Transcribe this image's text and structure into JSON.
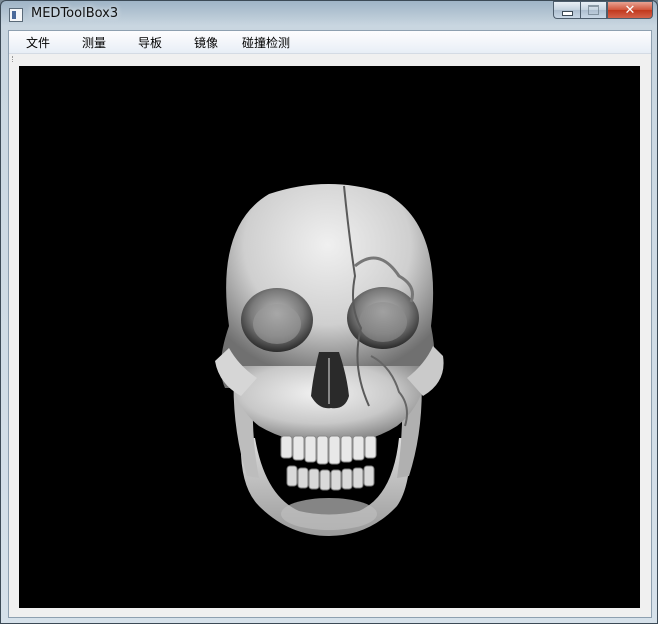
{
  "window": {
    "title": "MEDToolBox3"
  },
  "menu": {
    "items": [
      {
        "label": "文件"
      },
      {
        "label": "测量"
      },
      {
        "label": "导板"
      },
      {
        "label": "镜像"
      },
      {
        "label": "碰撞检测"
      }
    ]
  },
  "viewport": {
    "background": "#000000",
    "model": "skull-3d-render"
  },
  "colors": {
    "bone": "#d8d8d8",
    "close_button": "#c7462b"
  }
}
